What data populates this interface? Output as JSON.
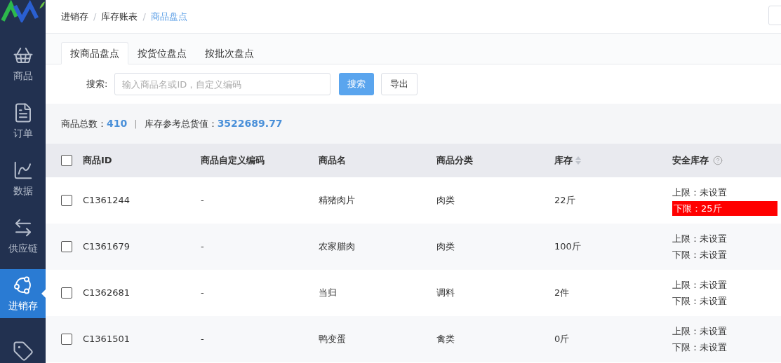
{
  "sidebar": {
    "items": [
      {
        "kind": "basket",
        "label": "商品",
        "selected": false
      },
      {
        "kind": "order",
        "label": "订单",
        "selected": false
      },
      {
        "kind": "chart",
        "label": "数据",
        "selected": false
      },
      {
        "kind": "arrows",
        "label": "供应链",
        "selected": false
      },
      {
        "kind": "cycle",
        "label": "进销存",
        "selected": true
      },
      {
        "kind": "tag",
        "selected": false
      }
    ]
  },
  "breadcrumb": [
    {
      "label": "进销存",
      "selected": false
    },
    {
      "separator": "/",
      "label": "库存账表",
      "selected": false
    },
    {
      "separator": "/",
      "label": "商品盘点",
      "selected": true
    }
  ],
  "tabs": [
    {
      "label": "按商品盘点",
      "selected": true
    },
    {
      "label": "按货位盘点",
      "selected": false
    },
    {
      "label": "按批次盘点",
      "selected": false
    }
  ],
  "search": {
    "label": "搜索:",
    "placeholder": "输入商品名或ID，自定义编码",
    "search_button": "搜索",
    "export_button": "导出"
  },
  "summary": {
    "count_label": "商品总数：",
    "count": "410",
    "separator": "|",
    "value_label": "库存参考总货值：",
    "value": "3522689.77"
  },
  "table": {
    "all_checked": false,
    "columns": [
      {
        "label": "商品ID"
      },
      {
        "label": "商品自定义编码"
      },
      {
        "label": "商品名"
      },
      {
        "label": "商品分类"
      },
      {
        "label": "库存",
        "sortable": true
      },
      {
        "label": "安全库存",
        "help": true
      }
    ],
    "rows": [
      {
        "checked": false,
        "id": "C1361244",
        "code": "-",
        "name": "精猪肉片",
        "category": "肉类",
        "stock": "22斤",
        "safety": [
          {
            "text": "上限：未设置",
            "alert": false
          },
          {
            "text": "下限：25斤",
            "alert": true
          }
        ]
      },
      {
        "checked": false,
        "id": "C1361679",
        "code": "-",
        "name": "农家腊肉",
        "category": "肉类",
        "stock": "100斤",
        "safety": [
          {
            "text": "上限：未设置",
            "alert": false
          },
          {
            "text": "下限：未设置",
            "alert": false
          }
        ]
      },
      {
        "checked": false,
        "id": "C1362681",
        "code": "-",
        "name": "当归",
        "category": "调料",
        "stock": "2件",
        "safety": [
          {
            "text": "上限：未设置",
            "alert": false
          },
          {
            "text": "下限：未设置",
            "alert": false
          }
        ]
      },
      {
        "checked": false,
        "id": "C1361501",
        "code": "-",
        "name": "鸭变蛋",
        "category": "禽类",
        "stock": "0斤",
        "safety": [
          {
            "text": "上限：未设置",
            "alert": false
          },
          {
            "text": "下限：未设置",
            "alert": false
          }
        ]
      }
    ]
  }
}
